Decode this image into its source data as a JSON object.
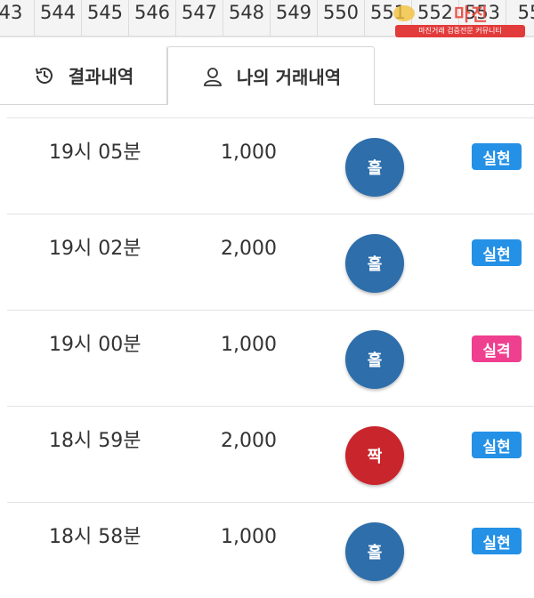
{
  "round_numbers": [
    "43",
    "544",
    "545",
    "546",
    "547",
    "548",
    "549",
    "550",
    "551",
    "552",
    "553",
    "55"
  ],
  "watermark": {
    "logo_text": "마진",
    "subtitle": "마진거래 검증전문 커뮤니티"
  },
  "tabs": [
    {
      "label": "결과내역",
      "icon": "history-icon"
    },
    {
      "label": "나의 거래내역",
      "icon": "user-icon"
    }
  ],
  "rows": [
    {
      "time": "19시 05분",
      "amount": "1,000",
      "pick": "홀",
      "status": "실현"
    },
    {
      "time": "19시 02분",
      "amount": "2,000",
      "pick": "홀",
      "status": "실현"
    },
    {
      "time": "19시 00분",
      "amount": "1,000",
      "pick": "홀",
      "status": "실격"
    },
    {
      "time": "18시 59분",
      "amount": "2,000",
      "pick": "짝",
      "status": "실현"
    },
    {
      "time": "18시 58분",
      "amount": "1,000",
      "pick": "홀",
      "status": "실현"
    }
  ],
  "colors": {
    "odd": "#2e6eab",
    "even": "#c9252c",
    "realized": "#2491e6",
    "disqualified": "#ef3f8f"
  }
}
